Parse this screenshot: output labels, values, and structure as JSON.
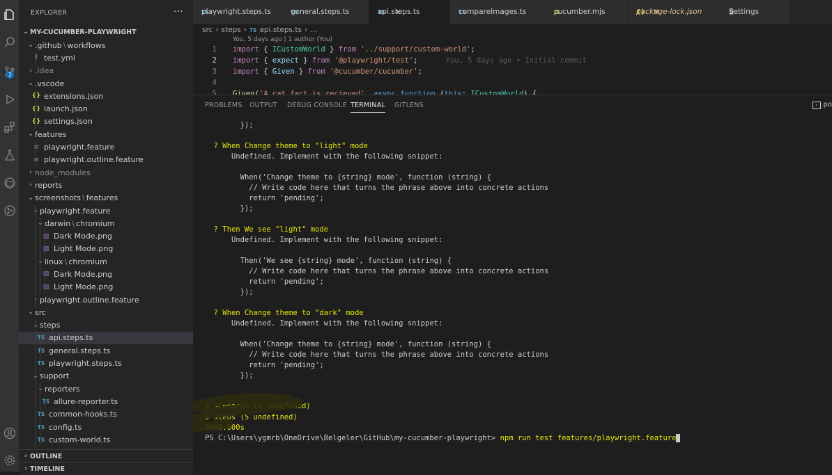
{
  "explorer": {
    "title": "EXPLORER",
    "more": "···",
    "root": "MY-CUCUMBER-PLAYWRIGHT",
    "items": [
      {
        "label": "",
        "parts": [
          ".github",
          "\\",
          "workflows"
        ],
        "type": "folder",
        "open": true
      },
      {
        "label": "test.yml",
        "type": "yml"
      },
      {
        "label": ".idea",
        "type": "folder",
        "open": false,
        "dim": true
      },
      {
        "label": ".vscode",
        "type": "folder",
        "open": true
      },
      {
        "label": "extensions.json",
        "type": "json"
      },
      {
        "label": "launch.json",
        "type": "json"
      },
      {
        "label": "settings.json",
        "type": "json"
      },
      {
        "label": "features",
        "type": "folder",
        "open": true
      },
      {
        "label": "playwright.feature",
        "type": "feature"
      },
      {
        "label": "playwright.outline.feature",
        "type": "feature"
      },
      {
        "label": "node_modules",
        "type": "folder",
        "open": false,
        "dim": true
      },
      {
        "label": "reports",
        "type": "folder",
        "open": false
      },
      {
        "label": "",
        "parts": [
          "screenshots",
          "\\",
          "features"
        ],
        "type": "folder",
        "open": true
      },
      {
        "label": "playwright.feature",
        "type": "folder",
        "open": true
      },
      {
        "label": "",
        "parts": [
          "darwin",
          "\\",
          "chromium"
        ],
        "type": "folder",
        "open": true
      },
      {
        "label": "Dark Mode.png",
        "type": "png"
      },
      {
        "label": "Light Mode.png",
        "type": "png"
      },
      {
        "label": "",
        "parts": [
          "linux",
          "\\",
          "chromium"
        ],
        "type": "folder",
        "open": true
      },
      {
        "label": "Dark Mode.png",
        "type": "png"
      },
      {
        "label": "Light Mode.png",
        "type": "png"
      },
      {
        "label": "playwright.outline.feature",
        "type": "folder",
        "open": false
      },
      {
        "label": "src",
        "type": "folder",
        "open": true
      },
      {
        "label": "steps",
        "type": "folder",
        "open": true
      },
      {
        "label": "api.steps.ts",
        "type": "ts",
        "selected": true
      },
      {
        "label": "general.steps.ts",
        "type": "ts"
      },
      {
        "label": "playwright.steps.ts",
        "type": "ts"
      },
      {
        "label": "support",
        "type": "folder",
        "open": true
      },
      {
        "label": "reporters",
        "type": "folder",
        "open": true
      },
      {
        "label": "allure-reporter.ts",
        "type": "ts"
      },
      {
        "label": "common-hooks.ts",
        "type": "ts"
      },
      {
        "label": "config.ts",
        "type": "ts"
      },
      {
        "label": "custom-world.ts",
        "type": "ts"
      }
    ],
    "outline": "OUTLINE",
    "timeline": "TIMELINE"
  },
  "activity": {
    "scm_badge": "2"
  },
  "tabs": [
    {
      "label": "playwright.steps.ts",
      "icon": "TS"
    },
    {
      "label": "general.steps.ts",
      "icon": "TS"
    },
    {
      "label": "api.steps.ts",
      "icon": "TS",
      "active": true,
      "close": "✕"
    },
    {
      "label": "compareImages.ts",
      "icon": "TS"
    },
    {
      "label": "cucumber.mjs",
      "icon": "JS"
    },
    {
      "label": "package-lock.json",
      "icon": "{}",
      "modified": "M"
    },
    {
      "label": "Settings",
      "icon": "≣"
    }
  ],
  "breadcrumb": {
    "a": "src",
    "b": "steps",
    "c": "api.steps.ts",
    "d": "..."
  },
  "editor": {
    "codelens": "You, 5 days ago | 1 author (You)",
    "blame": "You, 5 days ago • Initial commit",
    "lines": [
      {
        "n": "1",
        "k1": "import",
        "p1": " { ",
        "t": "ICustomWorld",
        "p2": " } ",
        "k2": "from",
        "s": "'../support/custom-world'",
        "e": ";"
      },
      {
        "n": "2",
        "k1": "import",
        "p1": " { ",
        "t": "expect",
        "p2": " } ",
        "k2": "from",
        "s": "'@playwright/test'",
        "e": ";"
      },
      {
        "n": "3",
        "k1": "import",
        "p1": " { ",
        "t": "Given",
        "p2": " } ",
        "k2": "from",
        "s": "'@cucumber/cucumber'",
        "e": ";"
      },
      {
        "n": "4"
      },
      {
        "n": "5",
        "f": "Given",
        "p1": "(",
        "s": "'A cat fact is recieved'",
        "p2": ", ",
        "k1": "async",
        "k2": "function",
        "p3": " (",
        "v": "this",
        "p4": ": ",
        "t": "ICustomWorld",
        "p5": ") {"
      }
    ]
  },
  "panel": {
    "tabs": [
      "PROBLEMS",
      "OUTPUT",
      "DEBUG CONSOLE",
      "TERMINAL",
      "GITLENS"
    ],
    "active": "TERMINAL",
    "right": "po"
  },
  "terminal": {
    "lines": [
      {
        "i": 8,
        "t": "});"
      },
      {
        "i": 2,
        "t": "? When Change theme to \"light\" mode",
        "y": true
      },
      {
        "i": 6,
        "t": "Undefined. Implement with the following snippet:"
      },
      {
        "i": 8,
        "t": "When('Change theme to {string} mode', function (string) {"
      },
      {
        "i": 10,
        "t": "// Write code here that turns the phrase above into concrete actions"
      },
      {
        "i": 10,
        "t": "return 'pending';"
      },
      {
        "i": 8,
        "t": "});"
      },
      {
        "i": 2,
        "t": "? Then We see \"light\" mode",
        "y": true
      },
      {
        "i": 6,
        "t": "Undefined. Implement with the following snippet:"
      },
      {
        "i": 8,
        "t": "Then('We see {string} mode', function (string) {"
      },
      {
        "i": 10,
        "t": "// Write code here that turns the phrase above into concrete actions"
      },
      {
        "i": 10,
        "t": "return 'pending';"
      },
      {
        "i": 8,
        "t": "});"
      },
      {
        "i": 2,
        "t": "? When Change theme to \"dark\" mode",
        "y": true
      },
      {
        "i": 6,
        "t": "Undefined. Implement with the following snippet:"
      },
      {
        "i": 8,
        "t": "When('Change theme to {string} mode', function (string) {"
      },
      {
        "i": 10,
        "t": "// Write code here that turns the phrase above into concrete actions"
      },
      {
        "i": 10,
        "t": "return 'pending';"
      },
      {
        "i": 8,
        "t": "});"
      },
      {
        "i": 0,
        "t": "1 scenario (1 undefined)",
        "y": true
      },
      {
        "i": 0,
        "t": "5 steps (5 undefined)",
        "y": true
      },
      {
        "i": 0,
        "t": "0m00.000s",
        "y": true
      }
    ],
    "prompt": "PS C:\\Users\\ygmrb\\OneDrive\\Belgeler\\GitHub\\my-cucumber-playwright>",
    "command": "npm run test features/playwright.feature"
  }
}
